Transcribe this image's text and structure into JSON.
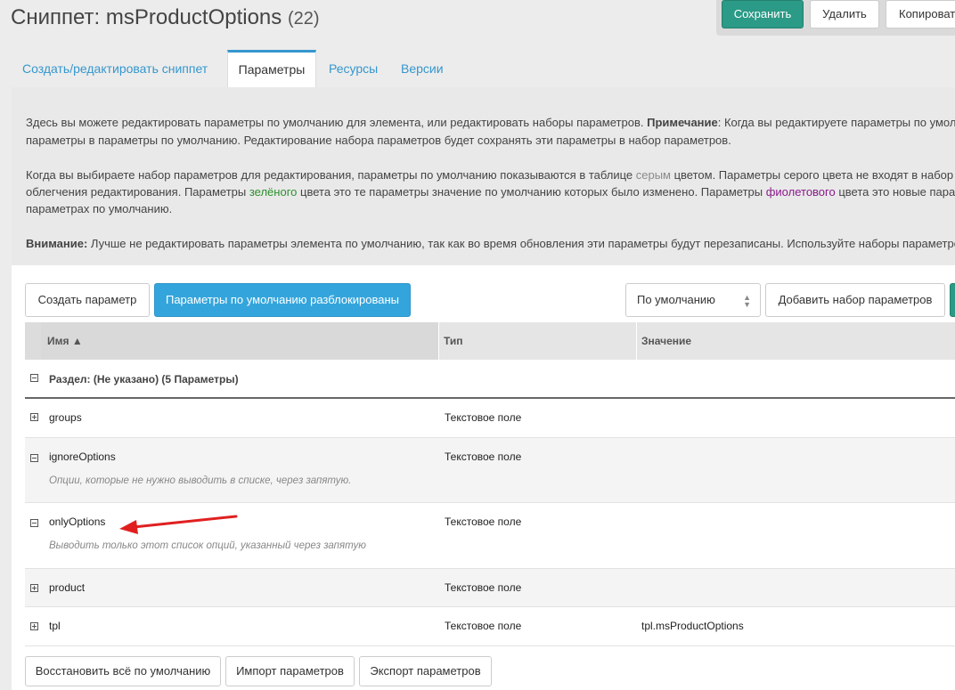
{
  "page": {
    "title": "Сниппет: msProductOptions",
    "count": "(22)"
  },
  "actions": {
    "save": "Сохранить",
    "delete": "Удалить",
    "copy": "Копироват"
  },
  "tabs": [
    {
      "label": "Создать/редактировать сниппет"
    },
    {
      "label": "Параметры"
    },
    {
      "label": "Ресурсы"
    },
    {
      "label": "Версии"
    }
  ],
  "info": {
    "p1_line1_a": "Здесь вы можете редактировать параметры по умолчанию для элемента, или редактировать наборы параметров. ",
    "p1_line1_b": "Примечание",
    "p1_line1_c": ": Когда вы редактируете параметры по умолч",
    "p1_line2": "параметры в параметры по умолчанию. Редактирование набора параметров будет сохранять эти параметры в набор параметров.",
    "p2_line1_a": "Когда вы выбираете набор параметров для редактирования, параметры по умолчанию показываются в таблице ",
    "p2_line1_gray": "серым",
    "p2_line1_b": " цветом. Параметры серого цвета не входят в набор па",
    "p2_line2_a": "облегчения редактирования. Параметры ",
    "p2_line2_green": "зелёного",
    "p2_line2_b": " цвета это те параметры значение по умолчанию которых было изменено. Параметры ",
    "p2_line2_purple": "фиолетового",
    "p2_line2_c": " цвета это новые парамет",
    "p2_line3": "параметрах по умолчанию.",
    "p3_bold": "Внимание:",
    "p3_text": " Лучше не редактировать параметры элемента по умолчанию, так как во время обновления эти параметры будут перезаписаны. Используйте наборы параметров"
  },
  "toolbar": {
    "create_param": "Создать параметр",
    "defaults_unlocked": "Параметры по умолчанию разблокированы",
    "property_set": "По умолчанию",
    "add_set": "Добавить набор параметров"
  },
  "grid": {
    "columns": [
      "Имя ▲",
      "Тип",
      "Значение"
    ],
    "group_label": "Раздел: (Не указано) (5 Параметры)",
    "rows": [
      {
        "name": "groups",
        "type": "Текстовое поле",
        "value": "",
        "desc": ""
      },
      {
        "name": "ignoreOptions",
        "type": "Текстовое поле",
        "value": "",
        "desc": "Опции, которые не нужно выводить в списке, через запятую."
      },
      {
        "name": "onlyOptions",
        "type": "Текстовое поле",
        "value": "",
        "desc": "Выводить только этот список опций, указанный через запятую"
      },
      {
        "name": "product",
        "type": "Текстовое поле",
        "value": "",
        "desc": ""
      },
      {
        "name": "tpl",
        "type": "Текстовое поле",
        "value": "tpl.msProductOptions",
        "desc": ""
      }
    ]
  },
  "footer": {
    "restore": "Восстановить всё по умолчанию",
    "import": "Импорт параметров",
    "export": "Экспорт параметров"
  },
  "colors": {
    "accent": "#3697cd",
    "save": "#2b9a86",
    "unlocked": "#34a5dc",
    "annotation_arrow": "#e02020"
  }
}
